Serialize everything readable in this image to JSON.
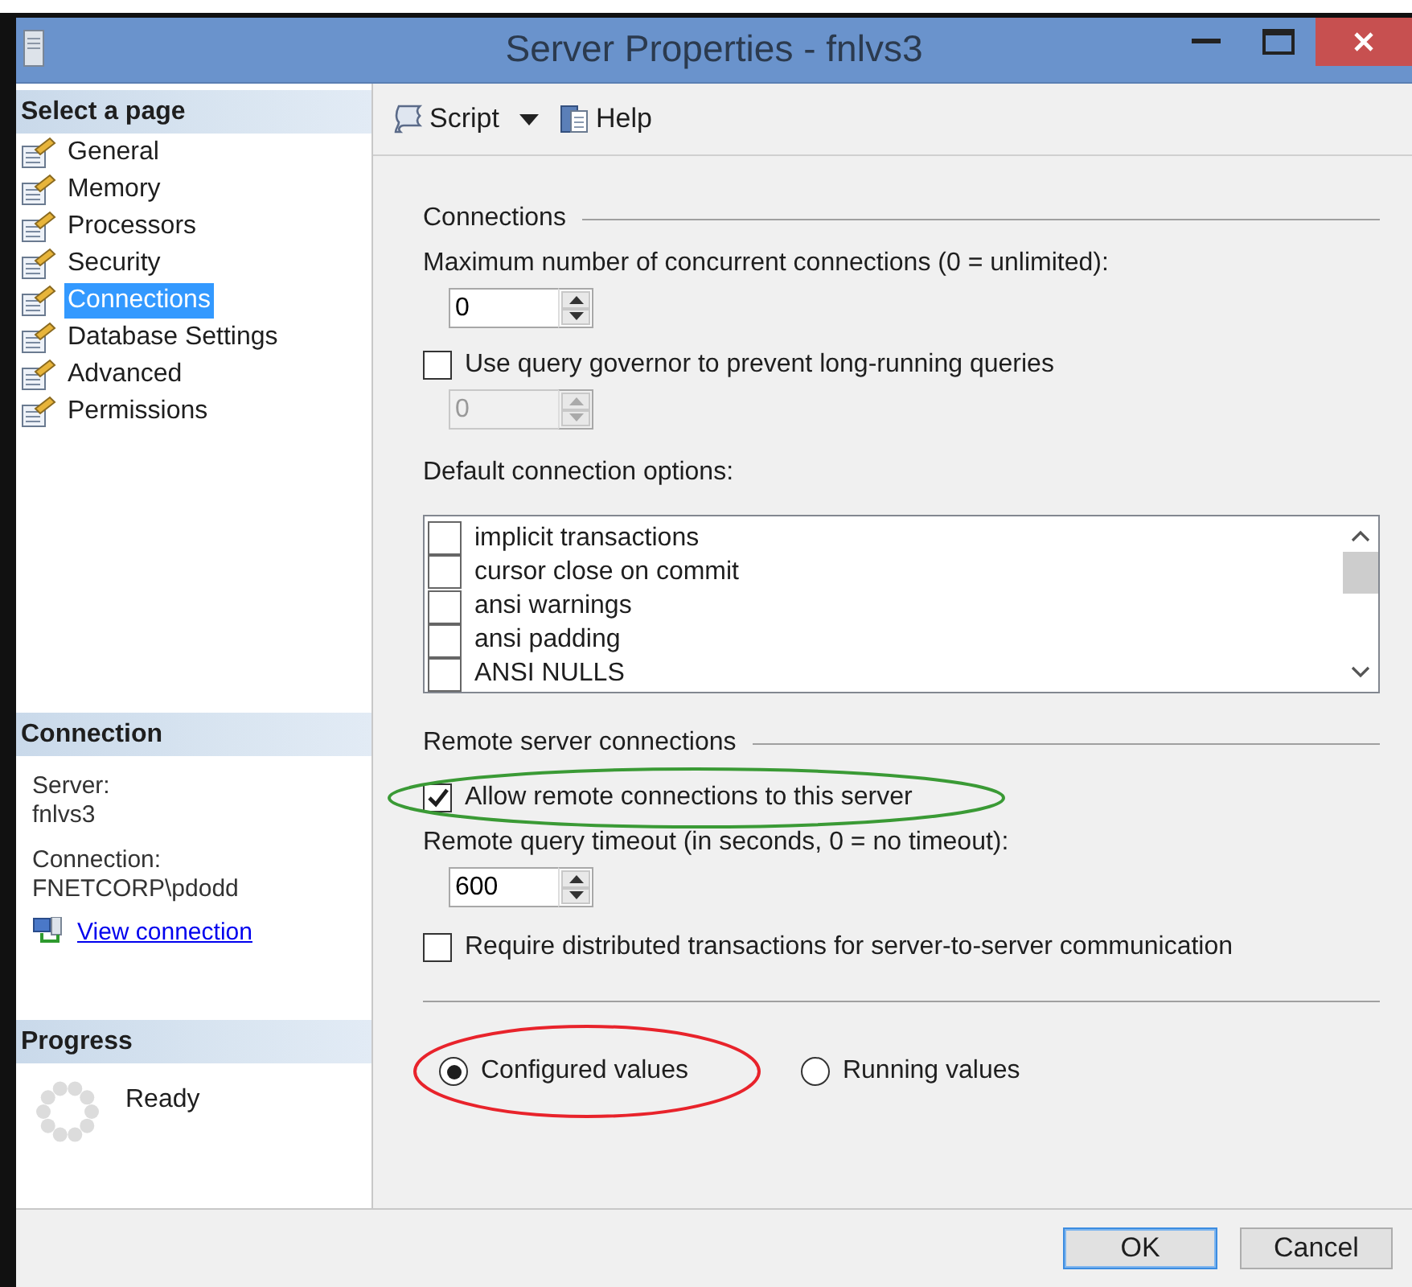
{
  "window": {
    "title": "Server Properties - fnlvs3"
  },
  "sidebar": {
    "header": "Select a page",
    "items": [
      {
        "label": "General",
        "selected": false
      },
      {
        "label": "Memory",
        "selected": false
      },
      {
        "label": "Processors",
        "selected": false
      },
      {
        "label": "Security",
        "selected": false
      },
      {
        "label": "Connections",
        "selected": true
      },
      {
        "label": "Database Settings",
        "selected": false
      },
      {
        "label": "Advanced",
        "selected": false
      },
      {
        "label": "Permissions",
        "selected": false
      }
    ],
    "connection": {
      "header": "Connection",
      "server_label": "Server:",
      "server": "fnlvs3",
      "connection_label": "Connection:",
      "connection": "FNETCORP\\pdodd",
      "link": "View connection"
    },
    "progress": {
      "header": "Progress",
      "status": "Ready"
    }
  },
  "toolbar": [
    {
      "label": "Script",
      "kind": "script"
    },
    {
      "label": "Help",
      "kind": "help"
    }
  ],
  "connections": {
    "title": "Connections",
    "max_label": "Maximum number of concurrent connections (0 = unlimited):",
    "max_value": "0",
    "governor": {
      "label": "Use query governor to prevent long-running queries",
      "checked": false
    },
    "governor_value": {
      "value": "0",
      "disabled": true
    },
    "options_label": "Default connection options:",
    "options": [
      {
        "label": "implicit transactions",
        "checked": false
      },
      {
        "label": "cursor close on commit",
        "checked": false
      },
      {
        "label": "ansi warnings",
        "checked": false
      },
      {
        "label": "ansi padding",
        "checked": false
      },
      {
        "label": "ANSI NULLS",
        "checked": false
      }
    ]
  },
  "remote": {
    "title": "Remote server connections",
    "allow": {
      "label": "Allow remote connections to this server",
      "checked": true,
      "annotation": {
        "color": "#3a9a35"
      }
    },
    "timeout_label": "Remote query timeout (in seconds, 0 = no timeout):",
    "timeout_value": "600",
    "distributed": {
      "label": "Require distributed transactions for server-to-server communication",
      "checked": false
    }
  },
  "values_mode": [
    {
      "label": "Configured values",
      "selected": true,
      "annotation": {
        "color": "#e8232b"
      }
    },
    {
      "label": "Running values",
      "selected": false
    }
  ],
  "buttons": [
    {
      "label": "OK",
      "kind": "default"
    },
    {
      "label": "Cancel",
      "kind": "normal"
    }
  ]
}
